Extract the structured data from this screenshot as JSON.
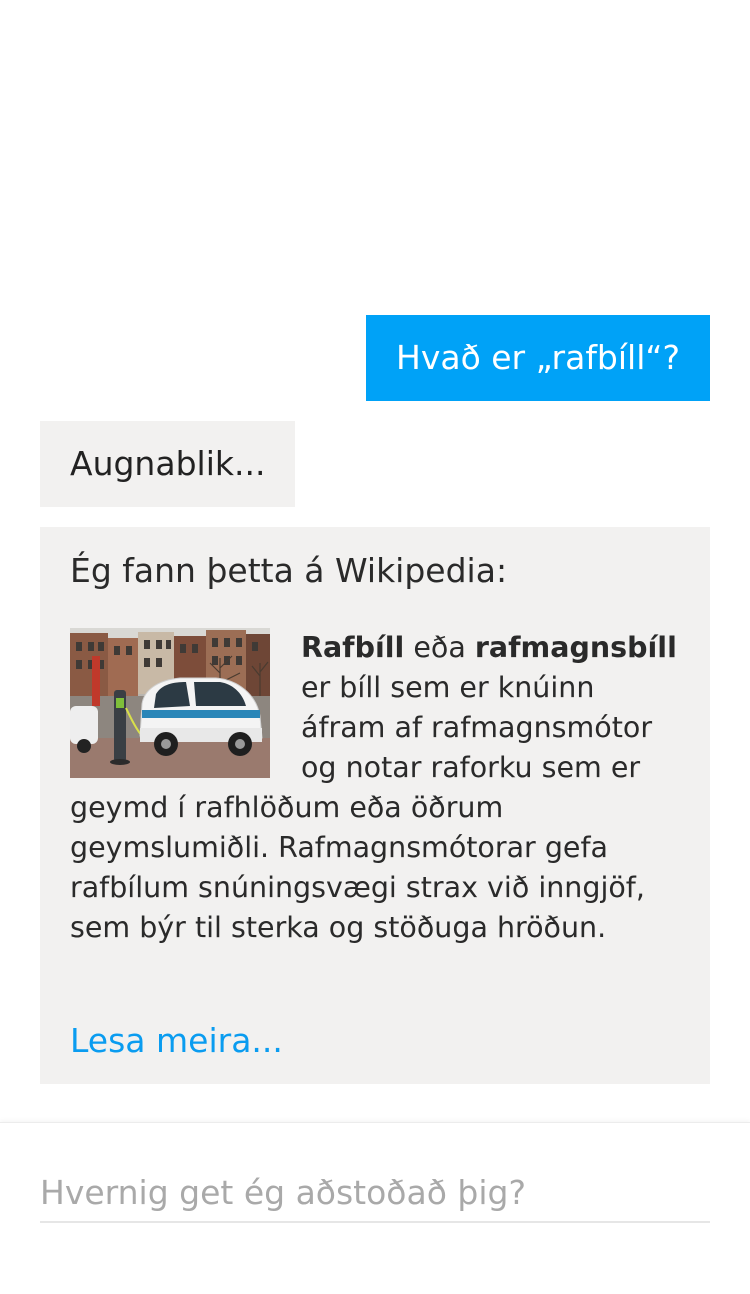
{
  "conversation": {
    "user_message": "Hvað er „rafbíll“?",
    "bot_wait_message": "Augnablik...",
    "wiki_card": {
      "intro": "Ég fann þetta á Wikipedia:",
      "term": "Rafbíll",
      "connector": " eða ",
      "alt_term": "rafmagnsbíll",
      "description": " er bíll sem er knúinn áfram af rafmagnsmótor og notar raforku sem er geymd í rafhlöðum eða öðrum geymslumiðli. Rafmagnsmótorar gefa rafbílum snúningsvægi strax við inngjöf, sem býr til sterka og stöðuga hröðun.",
      "read_more": "Lesa meira..."
    }
  },
  "input": {
    "placeholder": "Hvernig get ég aðstoðað þig?",
    "value": ""
  },
  "colors": {
    "user_bubble": "#00a2f7",
    "bot_bubble": "#f2f1f0",
    "link": "#0a9cf0"
  }
}
